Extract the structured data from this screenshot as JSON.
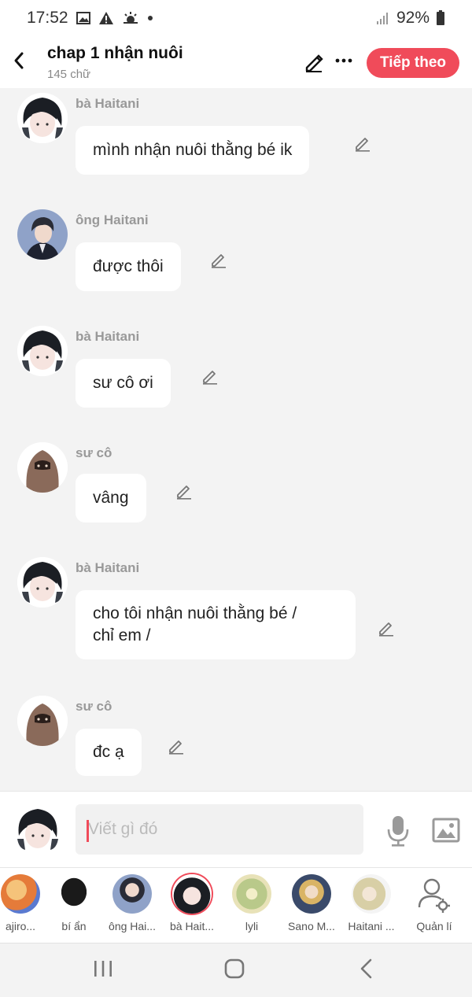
{
  "status": {
    "time": "17:52",
    "battery": "92%"
  },
  "header": {
    "title": "chap 1 nhận nuôi",
    "subtitle": "145 chữ",
    "next_label": "Tiếp theo"
  },
  "messages": [
    {
      "speaker": "bà Haitani",
      "text": "mình nhận nuôi thằng bé ik",
      "avatar": "black-curly-hair-avatar"
    },
    {
      "speaker": "ông Haitani",
      "text": "được thôi",
      "avatar": "suit-man-avatar"
    },
    {
      "speaker": "bà Haitani",
      "text": "sư cô ơi",
      "avatar": "black-curly-hair-avatar"
    },
    {
      "speaker": "sư cô",
      "text": "vâng",
      "avatar": "veiled-woman-avatar"
    },
    {
      "speaker": "bà Haitani",
      "text": "cho tôi nhận nuôi thằng bé /\nchỉ em /",
      "avatar": "black-curly-hair-avatar"
    },
    {
      "speaker": "sư cô",
      "text": "đc ạ",
      "avatar": "veiled-woman-avatar"
    }
  ],
  "composer": {
    "placeholder": "Viết gì đó"
  },
  "characters": [
    {
      "label": "ajiro...",
      "avatar": "orange-hair-avatar"
    },
    {
      "label": "bí ẩn",
      "avatar": "silhouette-avatar"
    },
    {
      "label": "ông Hai...",
      "avatar": "suit-man-avatar"
    },
    {
      "label": "bà Hait...",
      "avatar": "black-curly-hair-avatar",
      "selected": true
    },
    {
      "label": "lyli",
      "avatar": "floral-avatar"
    },
    {
      "label": "Sano M...",
      "avatar": "blonde-boy-avatar"
    },
    {
      "label": "Haitani ...",
      "avatar": "pale-blonde-avatar"
    },
    {
      "label": "Quản lí",
      "avatar": "user-settings-icon"
    }
  ],
  "colors": {
    "accent": "#f04b5a",
    "background": "#f3f3f3",
    "bubble": "#ffffff"
  }
}
